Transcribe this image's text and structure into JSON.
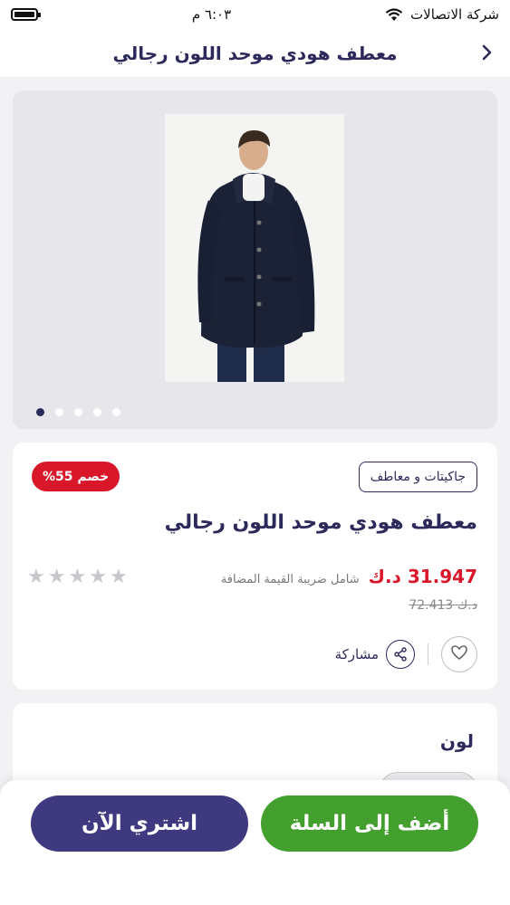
{
  "status_bar": {
    "carrier": "شركة الاتصالات",
    "time": "٦:٠٣ م"
  },
  "header": {
    "title": "معطف هودي موحد اللون رجالي",
    "back_icon": "chevron-right-icon"
  },
  "gallery": {
    "image_count": 5,
    "active_index": 0
  },
  "product": {
    "category": "جاكيتات و معاطف",
    "discount_badge": "خصم 55%",
    "name": "معطف هودي موحد اللون رجالي",
    "price": "31.947 د.ك",
    "tax_note": "شامل ضريبة القيمة المضافة",
    "old_price": "72.413 د.ك",
    "rating": 0,
    "rating_max": 5,
    "share_label": "مشاركة",
    "favorite_icon": "heart-icon",
    "share_icon": "share-icon"
  },
  "color_section": {
    "title": "لون"
  },
  "actions": {
    "add_to_cart": "أضف إلى السلة",
    "buy_now": "اشتري الآن"
  },
  "colors": {
    "primary": "#2c2a5a",
    "sale_red": "#d9172a",
    "cart_green": "#43a02f",
    "buy_purple": "#3f3a80"
  }
}
